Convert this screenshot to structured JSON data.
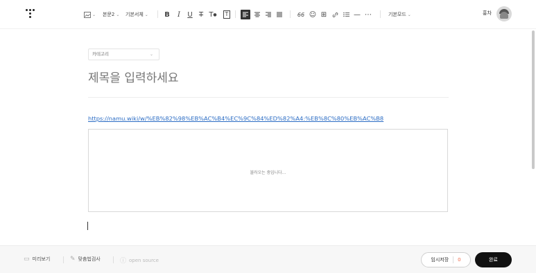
{
  "toolbar": {
    "image_icon": "image-icon",
    "paragraph_label": "본문2",
    "font_label": "기본서체",
    "bold": "B",
    "italic": "I",
    "underline": "U",
    "strike": "T",
    "text_color": "T",
    "text_bg": "T",
    "quote": "66",
    "mode_label": "기본모드"
  },
  "user": {
    "name": "홍차"
  },
  "editor": {
    "category_label": "카테고리",
    "title_placeholder": "제목을 입력하세요",
    "link_url": "https://namu.wiki/w/%EB%82%98%EB%AC%B4%EC%9C%84%ED%82%A4:%EB%8C%80%EB%AC%B8",
    "embed_loading": "불러오는 중입니다..."
  },
  "footer": {
    "preview_label": "미리보기",
    "spellcheck_label": "맞춤법검사",
    "opensource_label": "open source",
    "temp_save_label": "임시저장",
    "temp_save_count": "0",
    "done_label": "완료"
  },
  "colors": {
    "accent_link": "#2b6cc4",
    "save_count": "#f06a4a",
    "done_button": "#111111"
  }
}
